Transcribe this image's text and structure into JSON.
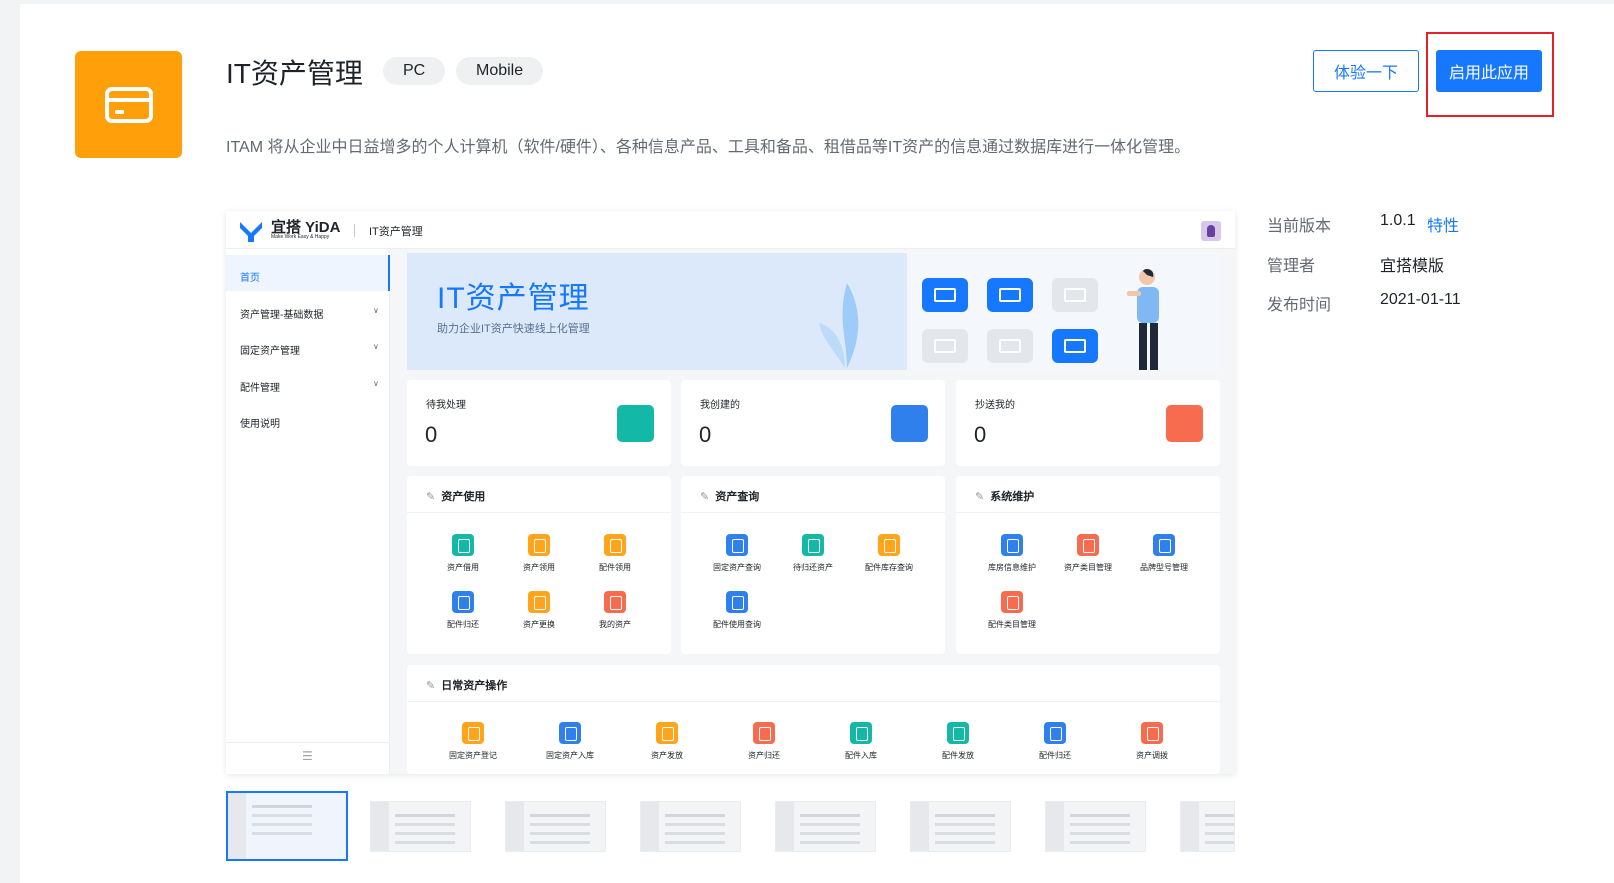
{
  "app": {
    "title": "IT资产管理",
    "tags": [
      "PC",
      "Mobile"
    ],
    "description": "ITAM 将从企业中日益增多的个人计算机（软件/硬件）、各种信息产品、工具和备品、租借品等IT资产的信息通过数据库进行一体化管理。",
    "icon": "credit-card-icon",
    "icon_color": "#ff9f0a"
  },
  "actions": {
    "try_label": "体验一下",
    "enable_label": "启用此应用",
    "accent": "#1677ff",
    "highlight_color": "#e6212a"
  },
  "meta": {
    "version_label": "当前版本",
    "version_value": "1.0.1",
    "version_link": "特性",
    "admin_label": "管理者",
    "admin_value": "宜搭模版",
    "publish_label": "发布时间",
    "publish_value": "2021-01-11"
  },
  "preview": {
    "logo_text": "宜搭 YiDA",
    "logo_sub": "Make Work Easy & Happy",
    "app_name": "IT资产管理",
    "nav": [
      "首页",
      "资产管理-基础数据",
      "固定资产管理",
      "配件管理",
      "使用说明"
    ],
    "banner_title": "IT资产管理",
    "banner_sub": "助力企业IT资产快速线上化管理",
    "stats": [
      {
        "label": "待我处理",
        "count": "0"
      },
      {
        "label": "我创建的",
        "count": "0"
      },
      {
        "label": "抄送我的",
        "count": "0"
      }
    ],
    "sections": [
      {
        "title": "资产使用",
        "items": [
          "资产借用",
          "资产领用",
          "配件领用",
          "配件归还",
          "资产更换",
          "我的资产"
        ]
      },
      {
        "title": "资产查询",
        "items": [
          "固定资产查询",
          "待归还资产",
          "配件库存查询",
          "配件使用查询"
        ]
      },
      {
        "title": "系统维护",
        "items": [
          "库房信息维护",
          "资产类目管理",
          "品牌型号管理",
          "配件类目管理"
        ]
      }
    ],
    "daily": {
      "title": "日常资产操作",
      "items": [
        "固定资产登记",
        "固定资产入库",
        "资产发放",
        "资产归还",
        "配件入库",
        "配件发放",
        "配件归还",
        "资产调拨"
      ]
    }
  }
}
